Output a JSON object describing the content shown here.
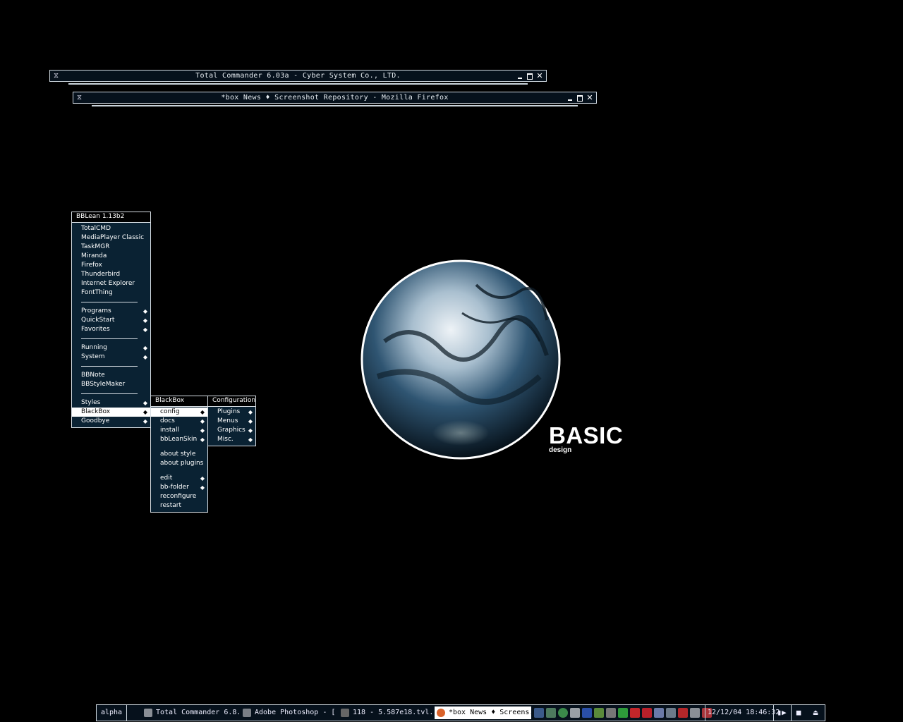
{
  "windows": {
    "total_commander": {
      "title": "Total Commander 6.03a - Cyber System Co., LTD."
    },
    "firefox": {
      "title": "*box News ♦ Screenshot Repository - Mozilla Firefox"
    }
  },
  "wallpaper": {
    "logo_big": "BASIC",
    "logo_small": "design"
  },
  "main_menu": {
    "title": "BBLean 1.13b2",
    "apps": [
      "TotalCMD",
      "MediaPlayer Classic",
      "TaskMGR",
      "Miranda",
      "Firefox",
      "Thunderbird",
      "Internet Explorer",
      "FontThing"
    ],
    "group1": [
      "Programs",
      "QuickStart",
      "Favorites"
    ],
    "group2": [
      "Running",
      "System"
    ],
    "group3": [
      "BBNote",
      "BBStyleMaker"
    ],
    "group4": [
      "Styles",
      "BlackBox",
      "Goodbye"
    ]
  },
  "blackbox_menu": {
    "title": "BlackBox",
    "items1": [
      "config",
      "docs",
      "install",
      "bbLeanSkin"
    ],
    "items2": [
      "about style",
      "about plugins"
    ],
    "items3": [
      "edit",
      "bb-folder",
      "reconfigure",
      "restart"
    ]
  },
  "config_menu": {
    "title": "Configuration",
    "items": [
      "Plugins",
      "Menus",
      "Graphics",
      "Misc."
    ]
  },
  "taskbar": {
    "workspace": "alpha",
    "tasks": [
      {
        "label": "Total Commander 6.8...",
        "icon": "total-commander-icon",
        "color": "#8a8f96"
      },
      {
        "label": "Adobe Photoshop - [...",
        "icon": "photoshop-icon",
        "color": "#7a7f86"
      },
      {
        "label": "118 - 5.587e18.tvl.mp...",
        "icon": "media-player-icon",
        "color": "#666"
      },
      {
        "label": "*box News ♦ Screens...",
        "icon": "firefox-icon",
        "color": "#d9622a"
      }
    ],
    "tray_icons": [
      "monitor-icon",
      "network-icon",
      "refresh-icon",
      "skull-icon",
      "bluetooth-icon",
      "plug-icon",
      "tools-icon",
      "green-bars-icon",
      "flash-icon",
      "acrobat-icon",
      "mail-icon",
      "settings-icon",
      "filezilla-icon",
      "usb-icon",
      "shield-icon"
    ],
    "clock": "12/12/04 18:46:32"
  }
}
